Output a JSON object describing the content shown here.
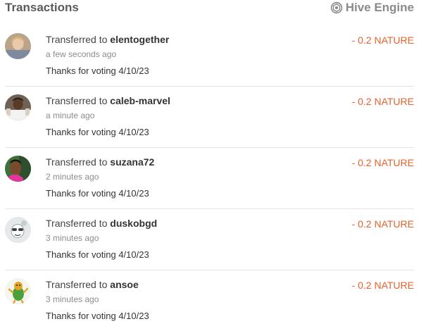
{
  "header": {
    "title": "Transactions",
    "engine_label": "Hive Engine",
    "engine_icon": "hive-engine-logo-icon"
  },
  "colors": {
    "amount": "#e8612c",
    "muted": "#8c8c8c",
    "divider": "#e3e3e3"
  },
  "transactions": [
    {
      "prefix": "Transferred to",
      "user": "elentogether",
      "time": "a few seconds ago",
      "memo": "Thanks for voting 4/10/23",
      "amount": "- 0.2 NATURE",
      "avatar": "user-avatar"
    },
    {
      "prefix": "Transferred to",
      "user": "caleb-marvel",
      "time": "a minute ago",
      "memo": "Thanks for voting 4/10/23",
      "amount": "- 0.2 NATURE",
      "avatar": "user-avatar"
    },
    {
      "prefix": "Transferred to",
      "user": "suzana72",
      "time": "2 minutes ago",
      "memo": "Thanks for voting 4/10/23",
      "amount": "- 0.2 NATURE",
      "avatar": "user-avatar"
    },
    {
      "prefix": "Transferred to",
      "user": "duskobgd",
      "time": "3 minutes ago",
      "memo": "Thanks for voting 4/10/23",
      "amount": "- 0.2 NATURE",
      "avatar": "user-avatar"
    },
    {
      "prefix": "Transferred to",
      "user": "ansoe",
      "time": "3 minutes ago",
      "memo": "Thanks for voting 4/10/23",
      "amount": "- 0.2 NATURE",
      "avatar": "user-avatar"
    }
  ]
}
